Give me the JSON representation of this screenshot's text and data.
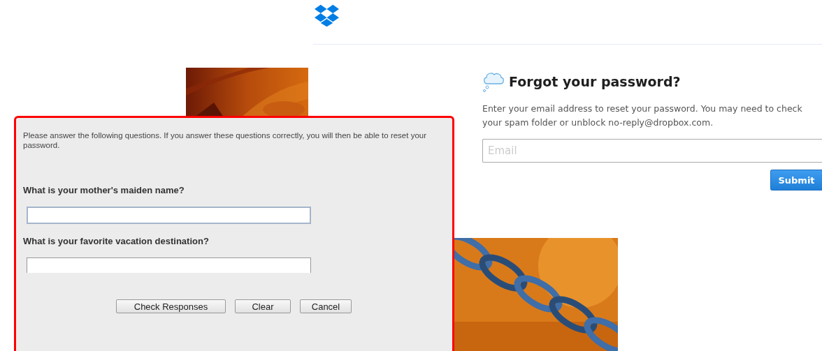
{
  "reset_page": {
    "heading": "Forgot your password?",
    "message": "Enter your email address to reset your password. You may need to check your spam folder or unblock no-reply@dropbox.com.",
    "email_field": {
      "placeholder": "Email"
    },
    "submit_button": "Submit"
  },
  "security_dialog": {
    "intro": "Please answer the following questions. If you answer these questions correctly, you will then be able to reset your password.",
    "questions": [
      {
        "label": "What is your mother's maiden name?",
        "focused": true
      },
      {
        "label": "What is your favorite vacation destination?",
        "focused": false
      }
    ],
    "buttons": [
      "Check Responses",
      "Clear",
      "Cancel"
    ]
  }
}
